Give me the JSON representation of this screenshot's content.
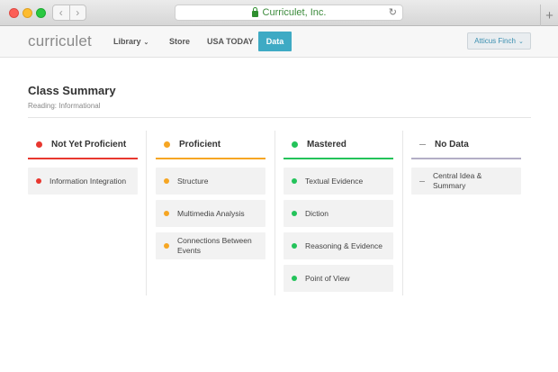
{
  "browser": {
    "url": "Curriculet, Inc.",
    "back": "‹",
    "forward": "›",
    "reload": "↻",
    "new_tab": "+"
  },
  "nav": {
    "logo": "curriculet",
    "library": "Library",
    "store": "Store",
    "usa_today": "USA TODAY",
    "data": "Data",
    "user": "Atticus Finch",
    "caret": "⌄"
  },
  "page": {
    "title": "Class Summary",
    "subtitle": "Reading: Informational"
  },
  "colors": {
    "not_yet": "#e8372f",
    "proficient": "#f6a623",
    "mastered": "#23c35a",
    "no_data": "#b3aec6",
    "accent": "#3eaac4"
  },
  "columns": [
    {
      "title": "Not Yet Proficient",
      "items": [
        "Information Integration"
      ]
    },
    {
      "title": "Proficient",
      "items": [
        "Structure",
        "Multimedia Analysis",
        "Connections Between Events"
      ]
    },
    {
      "title": "Mastered",
      "items": [
        "Textual Evidence",
        "Diction",
        "Reasoning & Evidence",
        "Point of View"
      ]
    },
    {
      "title": "No Data",
      "items": [
        "Central Idea & Summary"
      ]
    }
  ]
}
